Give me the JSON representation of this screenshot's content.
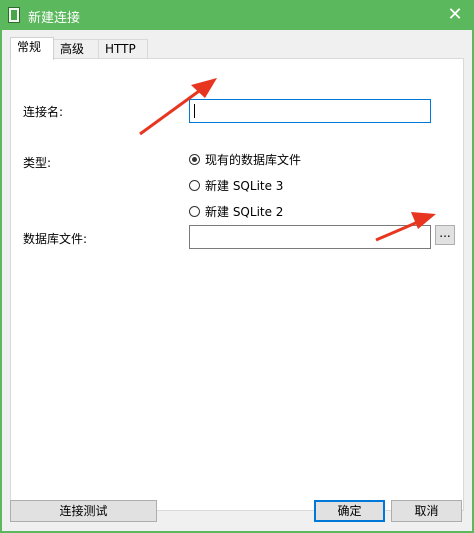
{
  "window": {
    "title": "新建连接",
    "icon": "database-file-icon",
    "close_glyph": "✕",
    "accent_color": "#5bb85d"
  },
  "tabs": [
    {
      "label": "常规",
      "active": true
    },
    {
      "label": "高级",
      "active": false
    },
    {
      "label": "HTTP",
      "active": false
    }
  ],
  "form": {
    "connection_name_label": "连接名:",
    "connection_name_value": "",
    "type_label": "类型:",
    "type_options": [
      {
        "label": "现有的数据库文件",
        "checked": true
      },
      {
        "label": "新建 SQLite 3",
        "checked": false
      },
      {
        "label": "新建 SQLite 2",
        "checked": false
      }
    ],
    "db_file_label": "数据库文件:",
    "db_file_value": "",
    "browse_label": "..."
  },
  "footer": {
    "test_label": "连接测试",
    "ok_label": "确定",
    "cancel_label": "取消"
  },
  "annotation_color": "#e8351f"
}
